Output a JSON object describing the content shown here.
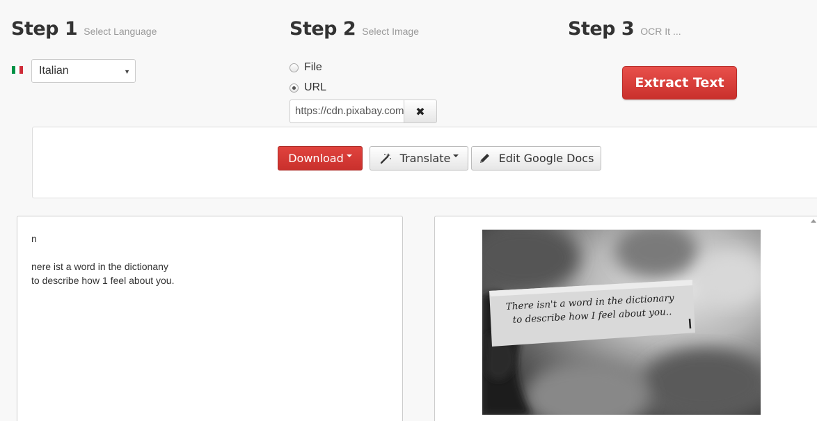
{
  "steps": [
    {
      "num": "Step 1",
      "sub": "Select Language"
    },
    {
      "num": "Step 2",
      "sub": "Select Image"
    },
    {
      "num": "Step 3",
      "sub": "OCR It ..."
    }
  ],
  "language": {
    "selected": "Italian",
    "flag_icon": "italy-flag-icon",
    "flag_colors": [
      "#009246",
      "#ffffff",
      "#ce2b37"
    ]
  },
  "source": {
    "options": [
      {
        "label": "File",
        "checked": false
      },
      {
        "label": "URL",
        "checked": true
      }
    ],
    "url_value": "https://cdn.pixabay.com",
    "clear_icon": "times-icon"
  },
  "extract_button": {
    "label": "Extract Text",
    "color": "#d9534f"
  },
  "toolbar": {
    "download_label": "Download",
    "download_color": "#d9534f",
    "translate_label": "Translate",
    "translate_icon": "magic-wand-icon",
    "gdocs_label": "Edit Google Docs",
    "gdocs_icon": "pencil-icon"
  },
  "result": {
    "line1": "n",
    "line2": "nere ist a word in the dictionany",
    "line3": "to describe how 1 feel about you."
  },
  "preview": {
    "note_line1": "There isn't a word in the dictionary",
    "note_line2": "to describe how I feel about you.."
  }
}
